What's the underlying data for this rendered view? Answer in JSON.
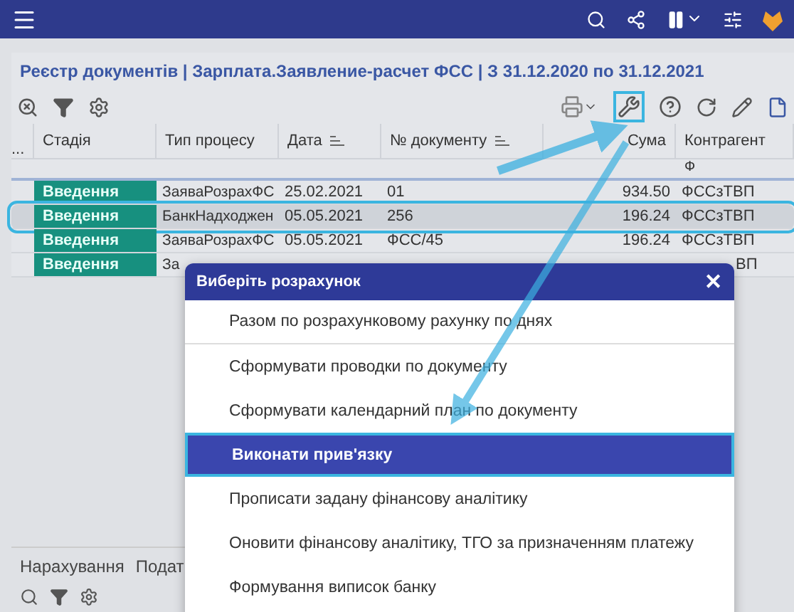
{
  "title": "Реєстр документів | Зарплата.Заявление-расчет ФСС | З 31.12.2020 по 31.12.2021",
  "columns": [
    {
      "label": "Стадія",
      "sortable": false
    },
    {
      "label": "Тип процесу",
      "sortable": false
    },
    {
      "label": "Дата",
      "sortable": true
    },
    {
      "label": "№ документу",
      "sortable": true
    },
    {
      "label": "Сума",
      "sortable": false
    },
    {
      "label": "Контрагент",
      "sortable": false
    }
  ],
  "select_column": "...",
  "filter_row": {
    "contragent": "Ф"
  },
  "rows": [
    {
      "stage": "Введення",
      "type": "ЗаяваРозрахФС",
      "date": "25.02.2021",
      "number": "01",
      "sum": "934.50",
      "contragent": "ФССзТВП",
      "selected": false
    },
    {
      "stage": "Введення",
      "type": "БанкНадходжен",
      "date": "05.05.2021",
      "number": "256",
      "sum": "196.24",
      "contragent": "ФССзТВП",
      "selected": true
    },
    {
      "stage": "Введення",
      "type": "ЗаяваРозрахФС",
      "date": "05.05.2021",
      "number": "ФСС/45",
      "sum": "196.24",
      "contragent": "ФССзТВП",
      "selected": false
    },
    {
      "stage": "Введення",
      "type": "За",
      "date": "",
      "number": "",
      "sum": "",
      "contragent": "ВП",
      "selected": false
    }
  ],
  "bottom_tabs": [
    {
      "label": "Нарахування",
      "selected": false
    },
    {
      "label": "Подат",
      "selected": false
    }
  ],
  "dialog": {
    "title": "Виберіть розрахунок",
    "close": "✕",
    "items": [
      {
        "label": "Разом по розрахунковому рахунку по днях",
        "selected": false
      },
      {
        "label": "Сформувати проводки по документу",
        "selected": false
      },
      {
        "label": "Сформувати календарний план по документу",
        "selected": false
      },
      {
        "label": "Виконати прив'язку",
        "selected": true
      },
      {
        "label": "Прописати задану фінансову аналітику",
        "selected": false
      },
      {
        "label": "Оновити фінансову аналітику, ТГО за призначенням платежу",
        "selected": false
      },
      {
        "label": "Формування виписок банку",
        "selected": false
      }
    ]
  }
}
